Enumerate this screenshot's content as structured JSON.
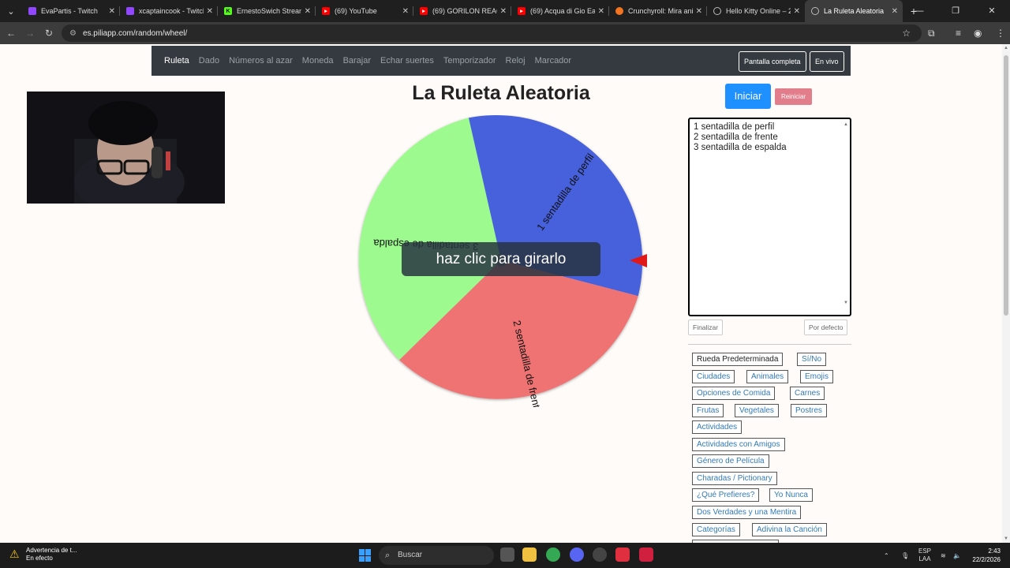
{
  "browser": {
    "tabs": [
      {
        "title": "EvaPartis - Twitch",
        "color": "#9146ff"
      },
      {
        "title": "xcaptaincook - Twitch",
        "color": "#9146ff"
      },
      {
        "title": "ErnestoSwich Stream",
        "color": "#53fc18"
      },
      {
        "title": "(69) YouTube",
        "color": "#ff0000"
      },
      {
        "title": "(69) GORILON REACC",
        "color": "#ff0000"
      },
      {
        "title": "(69) Acqua di Gio Eau",
        "color": "#ff0000"
      },
      {
        "title": "Crunchyroll: Mira ani",
        "color": "#f47521"
      },
      {
        "title": "Hello Kitty Online – 2",
        "color": "#888888"
      },
      {
        "title": "La Ruleta Aleatoria",
        "color": "#888888"
      }
    ],
    "url": "es.piliapp.com/random/wheel/"
  },
  "nav": {
    "items": [
      "Ruleta",
      "Dado",
      "Números al azar",
      "Moneda",
      "Barajar",
      "Echar suertes",
      "Temporizador",
      "Reloj",
      "Marcador"
    ],
    "fullscreen": "Pantalla completa",
    "live": "En vivo"
  },
  "wheel": {
    "title": "La Ruleta Aleatoria",
    "overlay": "haz clic para girarlo",
    "start": "Iniciar",
    "reset": "Reiniciar",
    "segments": [
      {
        "label": "1 sentadilla de perfil",
        "color": "#4661dc"
      },
      {
        "label": "2 sentadilla de frente",
        "color": "#f07373"
      },
      {
        "label": "3 sentadilla de espalda",
        "color": "#9dfa8f"
      }
    ],
    "pointer_color": "#e01818"
  },
  "editor": {
    "lines": [
      "1 sentadilla de perfil",
      "2 sentadilla de frente",
      "3 sentadilla de espalda"
    ],
    "finalize": "Finalizar",
    "default": "Por defecto"
  },
  "presets": [
    "Rueda Predeterminada",
    "Sí/No",
    "Ciudades",
    "Animales",
    "Emojis",
    "Opciones de Comida",
    "Carnes",
    "Frutas",
    "Vegetales",
    "Postres",
    "Actividades",
    "Actividades con Amigos",
    "Género de Película",
    "Charadas / Pictionary",
    "¿Qué Prefieres?",
    "Yo Nunca",
    "Dos Verdades y una Mentira",
    "Categorías",
    "Adivina la Canción"
  ],
  "taskbar": {
    "warning_title": "Advertencia de t...",
    "warning_sub": "En efecto",
    "search": "Buscar",
    "lang1": "ESP",
    "lang2": "LAA",
    "time": "2:43",
    "date": "22/2/2026"
  }
}
